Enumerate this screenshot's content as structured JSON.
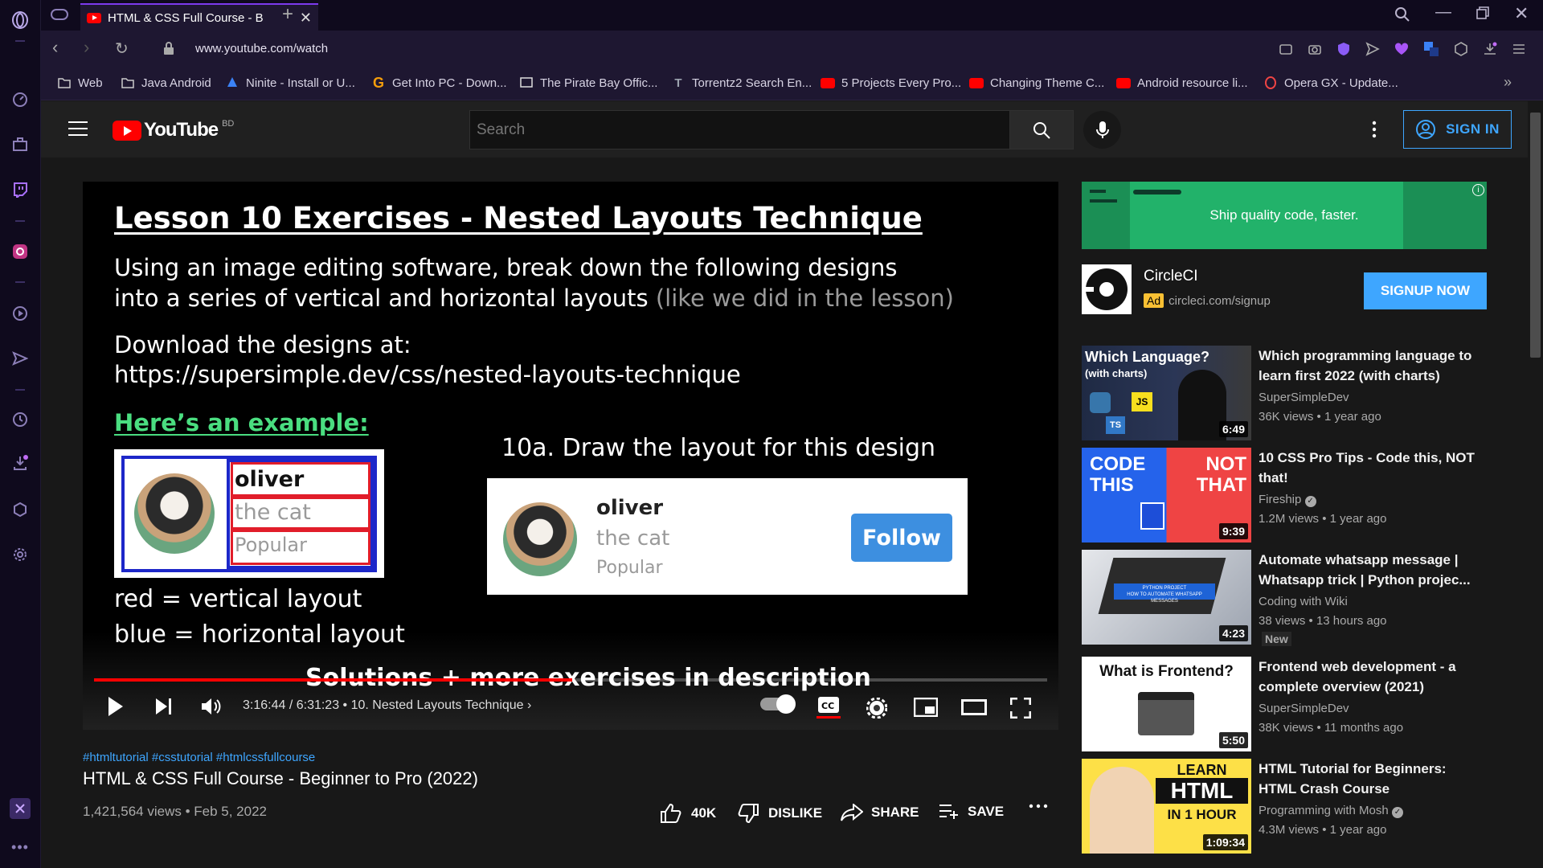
{
  "browser": {
    "tab_title": "HTML & CSS Full Course - B",
    "url": "www.youtube.com/watch",
    "bookmarks": [
      {
        "label": "Web",
        "icon": "folder-icon"
      },
      {
        "label": "Java Android",
        "icon": "folder-icon"
      },
      {
        "label": "Ninite - Install or U...",
        "icon": "ninite-icon"
      },
      {
        "label": "Get Into PC - Down...",
        "icon": "getintopc-icon"
      },
      {
        "label": "The Pirate Bay Offic...",
        "icon": "piratebay-icon"
      },
      {
        "label": "Torrentz2 Search En...",
        "icon": "torrentz-icon"
      },
      {
        "label": "5 Projects Every Pro...",
        "icon": "youtube-icon"
      },
      {
        "label": "Changing Theme C...",
        "icon": "youtube-icon"
      },
      {
        "label": "Android resource li...",
        "icon": "youtube-icon"
      },
      {
        "label": "Opera GX - Update...",
        "icon": "opera-icon"
      }
    ]
  },
  "youtube": {
    "logo_text": "YouTube",
    "region": "BD",
    "search_placeholder": "Search",
    "sign_in": "SIGN IN"
  },
  "video": {
    "slide": {
      "heading": "Lesson 10 Exercises - Nested Layouts Technique",
      "line1": "Using an image editing software, break down the following designs",
      "line2a": "into a series of vertical and horizontal layouts",
      "line2b": "(like we did in the lesson)",
      "line3": "Download the designs at:",
      "line4": "https://supersimple.dev/css/nested-layouts-technique",
      "example_label": "Here’s an example:",
      "exercise_label": "10a. Draw the layout for this design",
      "card_name": "oliver",
      "card_sub": "the cat",
      "card_tag": "Popular",
      "follow": "Follow",
      "legend_red": "red = vertical layout",
      "legend_blue": "blue = horizontal layout",
      "footer": "Solutions + more exercises in description"
    },
    "time": "3:16:44 / 6:31:23",
    "chapter": "10. Nested Layouts Technique",
    "progress": 0.502,
    "hashtags": "#htmltutorial #csstutorial #htmlcssfullcourse",
    "title": "HTML & CSS Full Course - Beginner to Pro (2022)",
    "views_date": "1,421,564 views • Feb 5, 2022",
    "likes": "40K",
    "dislike": "DISLIKE",
    "share": "SHARE",
    "save": "SAVE"
  },
  "ad": {
    "banner_text": "Ship quality code, faster.",
    "name": "CircleCI",
    "badge": "Ad",
    "url": "circleci.com/signup",
    "cta": "SIGNUP NOW"
  },
  "recommendations": [
    {
      "title": "Which programming language to learn first 2022 (with charts)",
      "channel": "SuperSimpleDev",
      "verified": false,
      "meta": "36K views • 1 year ago",
      "duration": "6:49",
      "thumb_text": "Which Language?",
      "thumb_sub": "(with charts)"
    },
    {
      "title": "10 CSS Pro Tips - Code this, NOT that!",
      "channel": "Fireship",
      "verified": true,
      "meta": "1.2M views • 1 year ago",
      "duration": "9:39",
      "thumb_text": "CODE THIS",
      "thumb_sub": "NOT THAT"
    },
    {
      "title": "Automate whatsapp message | Whatsapp trick | Python projec...",
      "channel": "Coding with Wiki",
      "verified": false,
      "meta": "38 views • 13 hours ago",
      "badge": "New",
      "duration": "4:23",
      "thumb_text": "PYTHON PROJECT",
      "thumb_sub": "HOW TO AUTOMATE WHATSAPP MESSAGES"
    },
    {
      "title": "Frontend web development - a complete overview (2021)",
      "channel": "SuperSimpleDev",
      "verified": false,
      "meta": "38K views • 11 months ago",
      "duration": "5:50",
      "thumb_text": "What is Frontend?"
    },
    {
      "title": "HTML Tutorial for Beginners: HTML Crash Course",
      "channel": "Programming with Mosh",
      "verified": true,
      "meta": "4.3M views • 1 year ago",
      "duration": "1:09:34",
      "thumb_text": "LEARN",
      "thumb_sub": "HTML",
      "thumb_sub2": "IN 1 HOUR"
    }
  ],
  "colors": {
    "accent": "#3ea6ff",
    "youtube_red": "#ff0000",
    "opera_purple": "#7c3aed",
    "ad_green": "#22b26a"
  }
}
